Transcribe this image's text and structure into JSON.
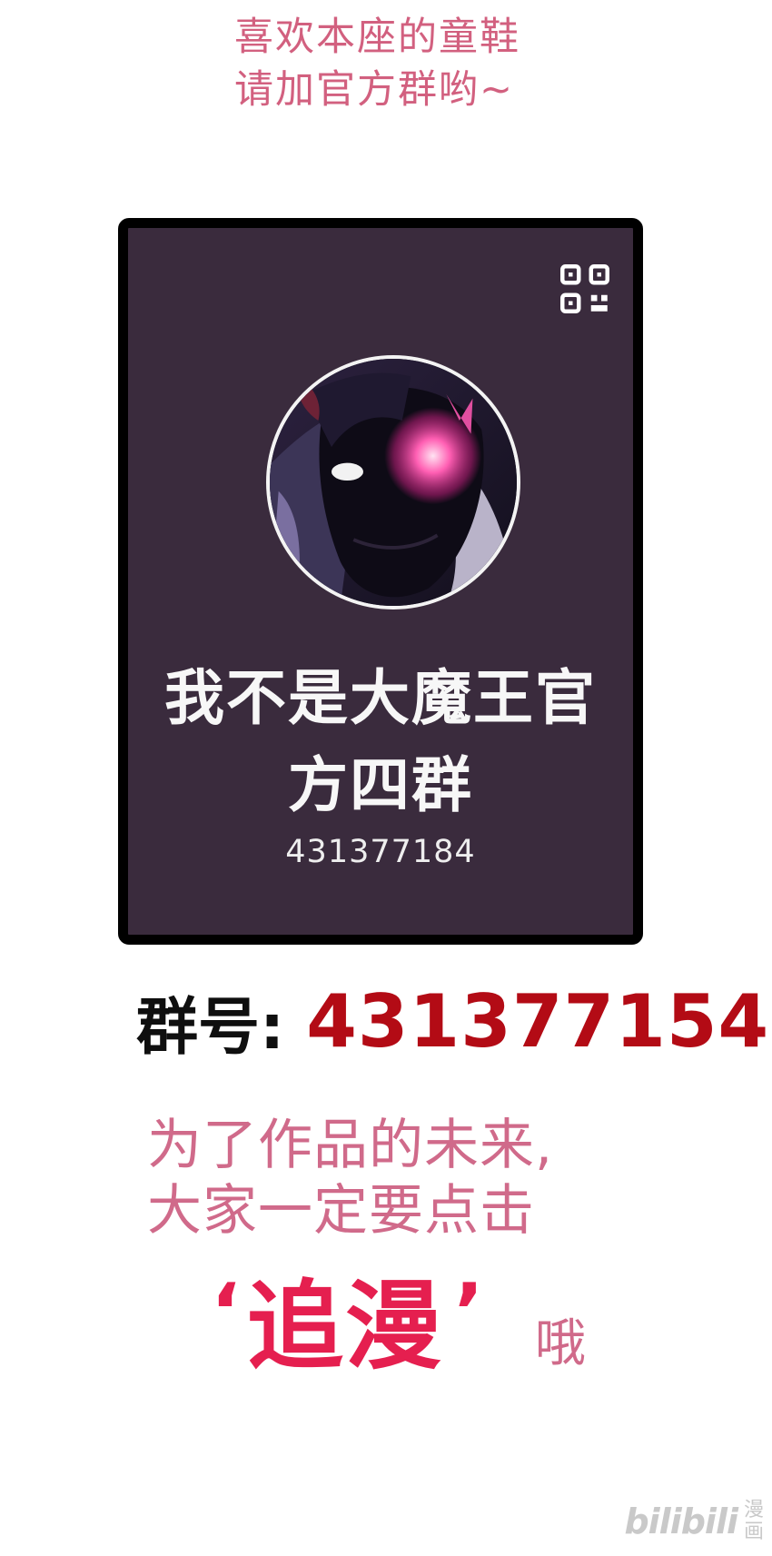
{
  "intro": {
    "line1": "喜欢本座的童鞋",
    "line2": "请加官方群哟~"
  },
  "card": {
    "name_line1": "我不是大魔王官",
    "name_line2": "方四群",
    "number": "431377184",
    "background_color": "#3a2b3d",
    "border_color": "#000000",
    "icons": {
      "qr": "qr-code-icon",
      "avatar": "villain-avatar-image"
    }
  },
  "group": {
    "label": "群号:",
    "number": "431377154",
    "number_color": "#b30b15"
  },
  "call_to_action": {
    "line1": "为了作品的未来,",
    "line2": "大家一定要点击",
    "quote_open": "‘",
    "follow_word": "追漫",
    "quote_close": "’",
    "ending": "哦",
    "accent_color": "#e51f4f"
  },
  "brand": {
    "name": "bilibili",
    "sub": "漫画"
  }
}
